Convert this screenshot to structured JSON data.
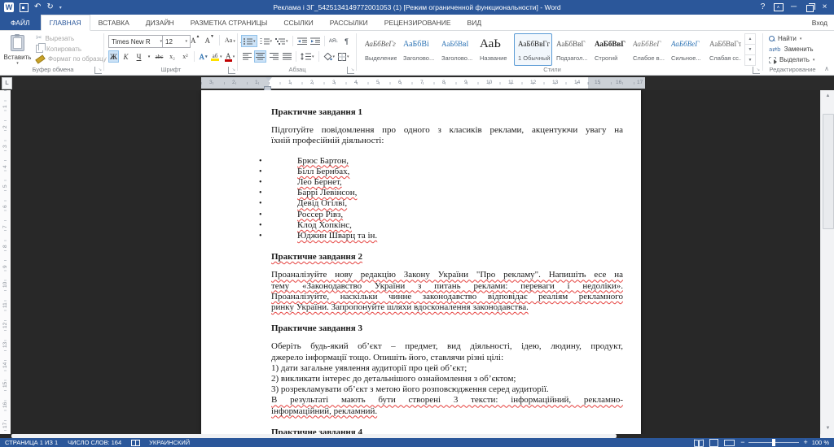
{
  "titlebar": {
    "title": "Реклама і ЗГ_5425134149772001053 (1) [Режим ограниченной функциональности] - Word",
    "signin": "Вход"
  },
  "icons": {
    "bullet": "•",
    "undo": "↶",
    "redo": "↻",
    "qat_caret": "▾",
    "help": "?",
    "minimize": "─",
    "close": "×",
    "collapse_ribbon": "∧",
    "scroll_up": "▲",
    "scroll_down": "▼",
    "tab_selector": "L",
    "pilcrow": "¶",
    "sort": "АЯ↓",
    "cut_glyph": "✂"
  },
  "tabs": {
    "file": "ФАЙЛ",
    "items": [
      {
        "label": "ГЛАВНАЯ",
        "active": true
      },
      {
        "label": "ВСТАВКА"
      },
      {
        "label": "ДИЗАЙН"
      },
      {
        "label": "РАЗМЕТКА СТРАНИЦЫ"
      },
      {
        "label": "ССЫЛКИ"
      },
      {
        "label": "РАССЫЛКИ"
      },
      {
        "label": "РЕЦЕНЗИРОВАНИЕ"
      },
      {
        "label": "ВИД"
      }
    ]
  },
  "ribbon": {
    "clipboard": {
      "label": "Буфер обмена",
      "paste": "Вставить",
      "cut": "Вырезать",
      "copy": "Копировать",
      "format_painter": "Формат по образцу"
    },
    "font": {
      "label": "Шрифт",
      "name": "Times New R",
      "size": "12",
      "bold": "Ж",
      "italic": "К",
      "underline": "Ч",
      "strike": "abc",
      "subscript": "x₂",
      "superscript": "x²",
      "grow": "А",
      "shrink": "А",
      "case": "Аа",
      "clear": "А",
      "effects": "А",
      "highlight": "аб",
      "fontcolor": "А"
    },
    "paragraph": {
      "label": "Абзац"
    },
    "styles": {
      "label": "Стили",
      "items": [
        {
          "sample": "АаБбВеГг",
          "name": "Выделение",
          "kind": "emphasis"
        },
        {
          "sample": "АаБбВі",
          "name": "Заголово...",
          "kind": "h1"
        },
        {
          "sample": "АаБбВвІ",
          "name": "Заголово...",
          "kind": "h2"
        },
        {
          "sample": "АаЬ",
          "name": "Название",
          "kind": "title"
        },
        {
          "sample": "АаБбВвГгД",
          "name": "1 Обычный",
          "kind": "normal",
          "selected": true
        },
        {
          "sample": "АаБбВвГ",
          "name": "Подзагол...",
          "kind": "subtitle"
        },
        {
          "sample": "АаБбВвГ",
          "name": "Строгий",
          "kind": "strict"
        },
        {
          "sample": "АаБбВеГ",
          "name": "Слабое в...",
          "kind": "subtle-em"
        },
        {
          "sample": "АаБбВеГ",
          "name": "Сильное...",
          "kind": "intense-em"
        },
        {
          "sample": "АаБбВвГт",
          "name": "Слабая сс...",
          "kind": "subtle-ref"
        }
      ]
    },
    "editing": {
      "label": "Редактирование",
      "find": "Найти",
      "replace": "Заменить",
      "select": "Выделить"
    }
  },
  "ruler": {
    "h_left": [
      "3",
      "2",
      "1"
    ],
    "h_main": [
      "1",
      "2",
      "3",
      "4",
      "5",
      "6",
      "7",
      "8",
      "9",
      "10",
      "11",
      "12",
      "13",
      "14"
    ],
    "h_right": [
      "15",
      "16",
      "17"
    ],
    "v": [
      "1",
      "2",
      "3",
      "4",
      "5",
      "6",
      "7",
      "8",
      "9",
      "10",
      "11",
      "12",
      "13",
      "14",
      "15",
      "16",
      "17"
    ]
  },
  "document": {
    "blocks": [
      {
        "type": "heading",
        "text": "Практичне завдання 1"
      },
      {
        "type": "para",
        "lines": [
          {
            "t": "Підготуйте повідомлення про одного з класиків реклами, акцентуючи увагу на",
            "j": true
          },
          {
            "t": "їхній професійній діяльності:"
          }
        ]
      },
      {
        "type": "bullets",
        "items": [
          "Брюс Бартон,",
          "Білл Бернбах,",
          "Лео Бернет,",
          "Баррі Левінсон,",
          "Девід Огілві,",
          "Россер Рівз,",
          "Клод Хопкінс,",
          "Юджин Шварц та ін."
        ]
      },
      {
        "type": "heading",
        "text": "Практичне завдання 2",
        "sq": true
      },
      {
        "type": "para",
        "lines": [
          {
            "t": "Проаналізуйте нову редакцію Закону України \"Про рекламу\". Напишіть есе на",
            "j": true,
            "sq": true
          },
          {
            "t": "тему «Законодавство України з питань реклами: переваги і недоліки».",
            "j": true,
            "sq": true
          },
          {
            "t": "Проаналізуйте, наскільки чинне законодавство відповідає реаліям рекламного",
            "j": true,
            "sq": true
          },
          {
            "t": "ринку України. Запропонуйте шляхи вдосконалення законодавства.",
            "sq": true
          }
        ]
      },
      {
        "type": "heading",
        "text": "Практичне завдання 3"
      },
      {
        "type": "para",
        "lines": [
          {
            "t": "Оберіть будь-який об’єкт – предмет, вид діяльності, ідею, людину, продукт,",
            "j": true
          },
          {
            "t": "джерело інформації тощо. Опишіть його, ставлячи різні цілі:"
          },
          {
            "t": "1) дати загальне уявлення аудиторії про цей об’єкт;"
          },
          {
            "t": "2) викликати інтерес до детальнішого ознайомлення з об’єктом;"
          },
          {
            "t": "3) розрекламувати об’єкт з метою його розповсюдження серед аудиторії."
          },
          {
            "t": "В результаті мають бути створені 3 тексти: інформаційний, рекламно-",
            "j": true,
            "sq": true
          },
          {
            "t": "інформаційний, рекламний.",
            "sq": true
          }
        ]
      },
      {
        "type": "heading",
        "text": "Практичне завдання 4"
      }
    ]
  },
  "statusbar": {
    "page": "СТРАНИЦА 1 ИЗ 1",
    "words": "ЧИСЛО СЛОВ: 164",
    "language": "УКРАИНСКИЙ",
    "zoom": "100 %"
  },
  "colors": {
    "accent": "#2b579a",
    "squiggle": "#e5413e",
    "selection": "#cde3f7",
    "highlight_yellow": "#ffe100",
    "font_color_red": "#c00000"
  }
}
